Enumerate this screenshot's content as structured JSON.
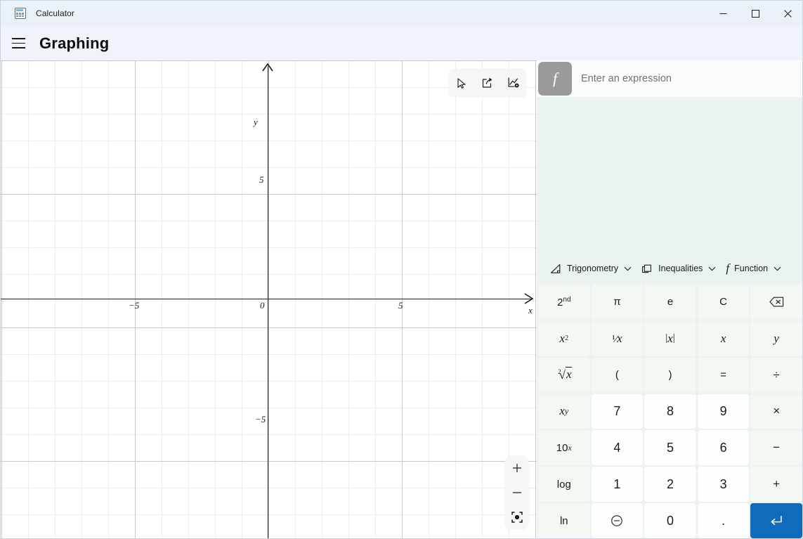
{
  "window": {
    "app_title": "Calculator",
    "app_icon": "calculator-icon",
    "minimize_label": "─",
    "maximize_label": "□",
    "close_label": "✕"
  },
  "header": {
    "menu_icon": "hamburger-icon",
    "page_title": "Graphing"
  },
  "graph": {
    "toolbar": [
      {
        "icon": "pointer-icon",
        "name": "graph-pointer-tool"
      },
      {
        "icon": "share-icon",
        "name": "graph-share-button"
      },
      {
        "icon": "graph-settings-icon",
        "name": "graph-options-button"
      }
    ],
    "zoom_controls": [
      {
        "icon": "plus-icon",
        "name": "zoom-in-button",
        "label": "+"
      },
      {
        "icon": "minus-icon",
        "name": "zoom-out-button",
        "label": "−"
      },
      {
        "icon": "reset-view-icon",
        "name": "reset-view-button",
        "label": ""
      }
    ],
    "axis_x_label": "x",
    "axis_y_label": "y",
    "x_ticks": [
      "−5",
      "0",
      "5"
    ],
    "y_ticks": [
      "5",
      "−5"
    ]
  },
  "expression": {
    "badge": "f",
    "placeholder": "Enter an expression",
    "value": ""
  },
  "categories": [
    {
      "label": "Trigonometry",
      "icon": "trigonometry-icon",
      "chevron": "chevron-down-icon"
    },
    {
      "label": "Inequalities",
      "icon": "inequalities-icon",
      "chevron": "chevron-down-icon"
    },
    {
      "label": "Function",
      "icon": "function-icon",
      "chevron": "chevron-down-icon"
    }
  ],
  "keypad": {
    "rows": [
      [
        {
          "name": "second-key",
          "label": "2nd",
          "kind": "fn",
          "sup": "nd",
          "base": "2"
        },
        {
          "name": "pi-key",
          "label": "π",
          "kind": "fn"
        },
        {
          "name": "e-key",
          "label": "e",
          "kind": "fn"
        },
        {
          "name": "clear-key",
          "label": "C",
          "kind": "fn"
        },
        {
          "name": "backspace-key",
          "label": "",
          "kind": "fn",
          "icon": "backspace-icon"
        }
      ],
      [
        {
          "name": "x-squared-key",
          "label": "x2",
          "kind": "fn",
          "italic": "x",
          "sup": "2"
        },
        {
          "name": "reciprocal-key",
          "label": "⅓x",
          "kind": "fn",
          "frac": "¹⁄x"
        },
        {
          "name": "absolute-value-key",
          "label": "|x|",
          "kind": "fn",
          "italic_bars": "x"
        },
        {
          "name": "x-variable-key",
          "label": "x",
          "kind": "fn",
          "italic": "x"
        },
        {
          "name": "y-variable-key",
          "label": "y",
          "kind": "fn",
          "italic": "y"
        }
      ],
      [
        {
          "name": "nth-root-key",
          "label": "√x",
          "kind": "fn",
          "icon": "nth-root-icon"
        },
        {
          "name": "open-paren-key",
          "label": "(",
          "kind": "fn"
        },
        {
          "name": "close-paren-key",
          "label": ")",
          "kind": "fn"
        },
        {
          "name": "equals-key",
          "label": "=",
          "kind": "fn"
        },
        {
          "name": "divide-key",
          "label": "÷",
          "kind": "op"
        }
      ],
      [
        {
          "name": "x-to-y-key",
          "label": "xy",
          "kind": "fn",
          "italic": "x",
          "sup_italic": "y"
        },
        {
          "name": "seven-key",
          "label": "7",
          "kind": "num"
        },
        {
          "name": "eight-key",
          "label": "8",
          "kind": "num"
        },
        {
          "name": "nine-key",
          "label": "9",
          "kind": "num"
        },
        {
          "name": "multiply-key",
          "label": "×",
          "kind": "op"
        }
      ],
      [
        {
          "name": "ten-to-x-key",
          "label": "10x",
          "kind": "fn",
          "base": "10",
          "sup_italic": "x"
        },
        {
          "name": "four-key",
          "label": "4",
          "kind": "num"
        },
        {
          "name": "five-key",
          "label": "5",
          "kind": "num"
        },
        {
          "name": "six-key",
          "label": "6",
          "kind": "num"
        },
        {
          "name": "subtract-key",
          "label": "−",
          "kind": "op"
        }
      ],
      [
        {
          "name": "log-key",
          "label": "log",
          "kind": "fn"
        },
        {
          "name": "one-key",
          "label": "1",
          "kind": "num"
        },
        {
          "name": "two-key",
          "label": "2",
          "kind": "num"
        },
        {
          "name": "three-key",
          "label": "3",
          "kind": "num"
        },
        {
          "name": "add-key",
          "label": "+",
          "kind": "op"
        }
      ],
      [
        {
          "name": "ln-key",
          "label": "ln",
          "kind": "fn"
        },
        {
          "name": "negate-key",
          "label": "(–)",
          "kind": "num"
        },
        {
          "name": "zero-key",
          "label": "0",
          "kind": "num"
        },
        {
          "name": "decimal-key",
          "label": ".",
          "kind": "num"
        },
        {
          "name": "enter-key",
          "label": "↵",
          "kind": "enter"
        }
      ]
    ]
  },
  "colors": {
    "accent": "#0f6cbd",
    "panel_bg": "#eaf3ef",
    "key_fn_bg": "#f3f8f3",
    "key_num_bg": "#fdfefd",
    "titlebar_bg": "#eaf1f7",
    "axis": "#1b1b1b",
    "grid_minor": "#ececec",
    "grid_major": "#c8c8c8"
  }
}
